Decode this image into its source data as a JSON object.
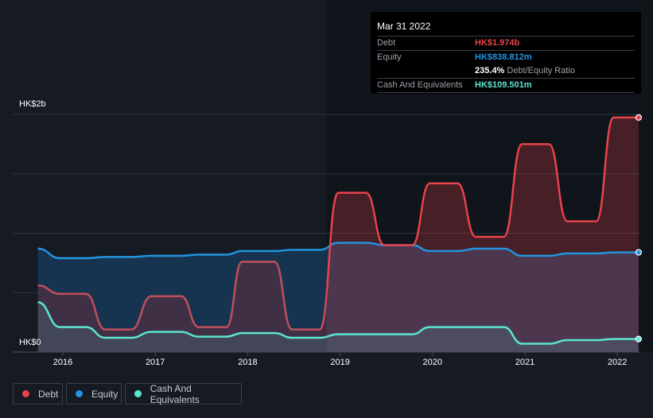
{
  "tooltip": {
    "date": "Mar 31 2022",
    "debt_label": "Debt",
    "debt_value": "HK$1.974b",
    "equity_label": "Equity",
    "equity_value": "HK$838.812m",
    "ratio_value": "235.4%",
    "ratio_label": "Debt/Equity Ratio",
    "cash_label": "Cash And Equivalents",
    "cash_value": "HK$109.501m"
  },
  "legend": [
    {
      "label": "Debt",
      "color": "#e8434b"
    },
    {
      "label": "Equity",
      "color": "#2394df"
    },
    {
      "label": "Cash And Equivalents",
      "color": "#5ce5cf"
    }
  ],
  "chart_data": {
    "type": "area",
    "title": "Debt to Equity History",
    "ylabel": "HK$",
    "ylim": [
      0,
      2.0
    ],
    "yunit": "HK$ billions",
    "y_tick_labels": [
      "HK$0",
      "HK$2b"
    ],
    "x_tick_labels": [
      "2016",
      "2017",
      "2018",
      "2019",
      "2020",
      "2021",
      "2022"
    ],
    "xlim": [
      2015.73,
      2022.23
    ],
    "grid": true,
    "legend_position": "bottom-left",
    "x": [
      2015.73,
      2015.97,
      2016.25,
      2016.46,
      2016.74,
      2016.96,
      2017.28,
      2017.47,
      2017.77,
      2017.94,
      2018.29,
      2018.48,
      2018.78,
      2018.98,
      2019.28,
      2019.48,
      2019.78,
      2019.97,
      2020.27,
      2020.47,
      2020.77,
      2020.97,
      2021.26,
      2021.46,
      2021.77,
      2021.96,
      2022.23
    ],
    "series": [
      {
        "name": "Debt",
        "color": "#e8434b",
        "values": [
          0.56,
          0.49,
          0.49,
          0.19,
          0.19,
          0.47,
          0.47,
          0.21,
          0.21,
          0.76,
          0.76,
          0.19,
          0.19,
          1.34,
          1.34,
          0.9,
          0.9,
          1.42,
          1.42,
          0.97,
          0.97,
          1.75,
          1.75,
          1.1,
          1.1,
          1.974,
          1.974
        ]
      },
      {
        "name": "Equity",
        "color": "#2394df",
        "values": [
          0.87,
          0.79,
          0.79,
          0.8,
          0.8,
          0.81,
          0.81,
          0.82,
          0.82,
          0.85,
          0.85,
          0.86,
          0.86,
          0.92,
          0.92,
          0.9,
          0.9,
          0.85,
          0.85,
          0.87,
          0.87,
          0.81,
          0.81,
          0.83,
          0.83,
          0.839,
          0.839
        ]
      },
      {
        "name": "Cash And Equivalents",
        "color": "#5ce5cf",
        "values": [
          0.42,
          0.21,
          0.21,
          0.12,
          0.12,
          0.17,
          0.17,
          0.13,
          0.13,
          0.16,
          0.16,
          0.12,
          0.12,
          0.15,
          0.15,
          0.15,
          0.15,
          0.21,
          0.21,
          0.21,
          0.21,
          0.07,
          0.07,
          0.1,
          0.1,
          0.1095,
          0.1095
        ]
      }
    ]
  }
}
